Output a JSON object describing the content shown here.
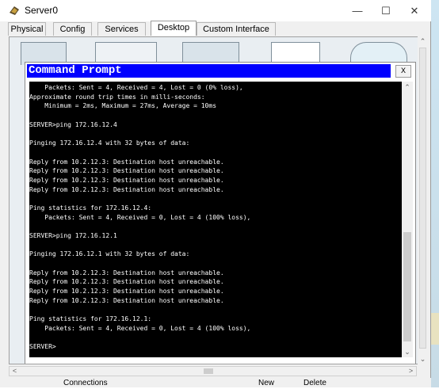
{
  "window": {
    "title": "Server0",
    "minimize_symbol": "—",
    "maximize_symbol": "☐",
    "close_symbol": "✕"
  },
  "tabs": [
    {
      "label": "Physical"
    },
    {
      "label": "Config"
    },
    {
      "label": "Services"
    },
    {
      "label": "Desktop",
      "active": true
    },
    {
      "label": "Custom Interface"
    }
  ],
  "command_prompt": {
    "title": "Command Prompt",
    "close_label": "X",
    "lines": [
      "    Packets: Sent = 4, Received = 4, Lost = 0 (0% loss),",
      "Approximate round trip times in milli-seconds:",
      "    Minimum = 2ms, Maximum = 27ms, Average = 10ms",
      "",
      "SERVER>ping 172.16.12.4",
      "",
      "Pinging 172.16.12.4 with 32 bytes of data:",
      "",
      "Reply from 10.2.12.3: Destination host unreachable.",
      "Reply from 10.2.12.3: Destination host unreachable.",
      "Reply from 10.2.12.3: Destination host unreachable.",
      "Reply from 10.2.12.3: Destination host unreachable.",
      "",
      "Ping statistics for 172.16.12.4:",
      "    Packets: Sent = 4, Received = 0, Lost = 4 (100% loss),",
      "",
      "SERVER>ping 172.16.12.1",
      "",
      "Pinging 172.16.12.1 with 32 bytes of data:",
      "",
      "Reply from 10.2.12.3: Destination host unreachable.",
      "Reply from 10.2.12.3: Destination host unreachable.",
      "Reply from 10.2.12.3: Destination host unreachable.",
      "Reply from 10.2.12.3: Destination host unreachable.",
      "",
      "Ping statistics for 172.16.12.1:",
      "    Packets: Sent = 4, Received = 0, Lost = 4 (100% loss),",
      "",
      "SERVER>"
    ]
  },
  "footer": {
    "connections_label": "Connections",
    "new_label": "New",
    "delete_label": "Delete"
  },
  "scroll": {
    "up": "⌃",
    "down": "⌄",
    "left": "<",
    "right": ">"
  }
}
